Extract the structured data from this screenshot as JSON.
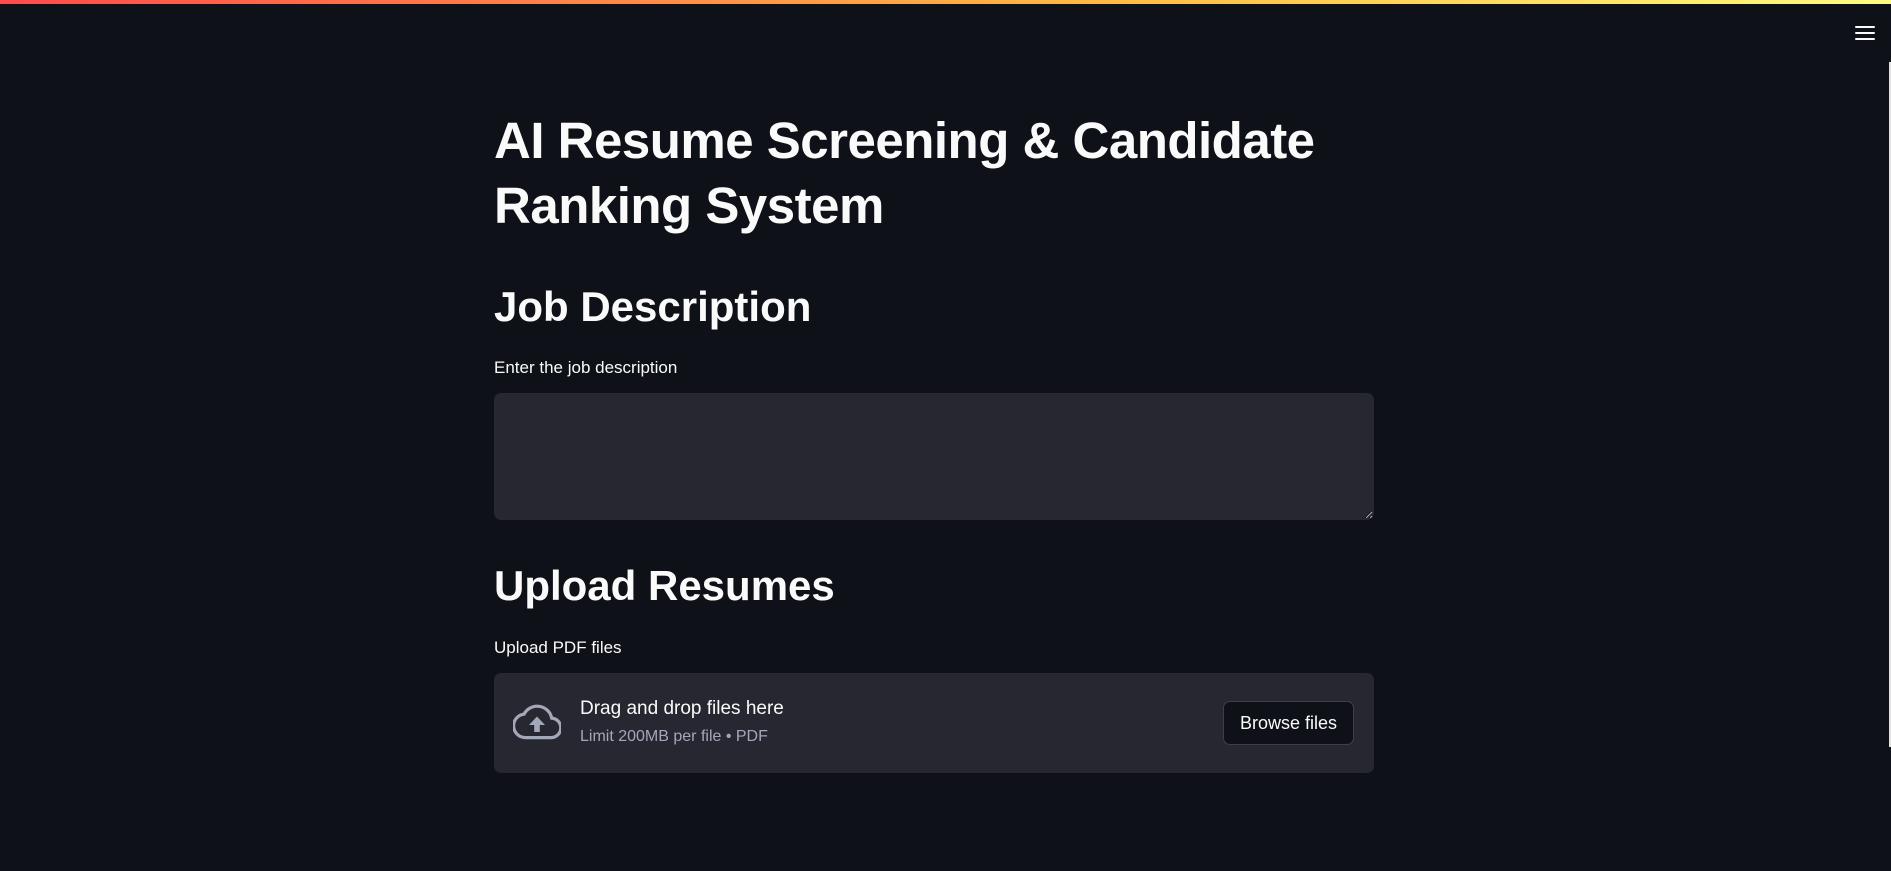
{
  "page": {
    "title": "AI Resume Screening & Candidate Ranking System"
  },
  "job_section": {
    "heading": "Job Description",
    "label": "Enter the job description",
    "textarea_value": ""
  },
  "upload_section": {
    "heading": "Upload Resumes",
    "label": "Upload PDF files",
    "dropzone_title": "Drag and drop files here",
    "dropzone_subtitle": "Limit 200MB per file • PDF",
    "browse_label": "Browse files"
  },
  "icons": {
    "menu": "hamburger-menu-icon",
    "upload": "cloud-upload-icon"
  },
  "colors": {
    "background": "#0e1117",
    "widget_background": "#262730",
    "text": "#fafafa",
    "muted_text": "#a3a8b8",
    "accent_gradient_start": "#ff4b4b",
    "accent_gradient_end": "#fffd80"
  }
}
